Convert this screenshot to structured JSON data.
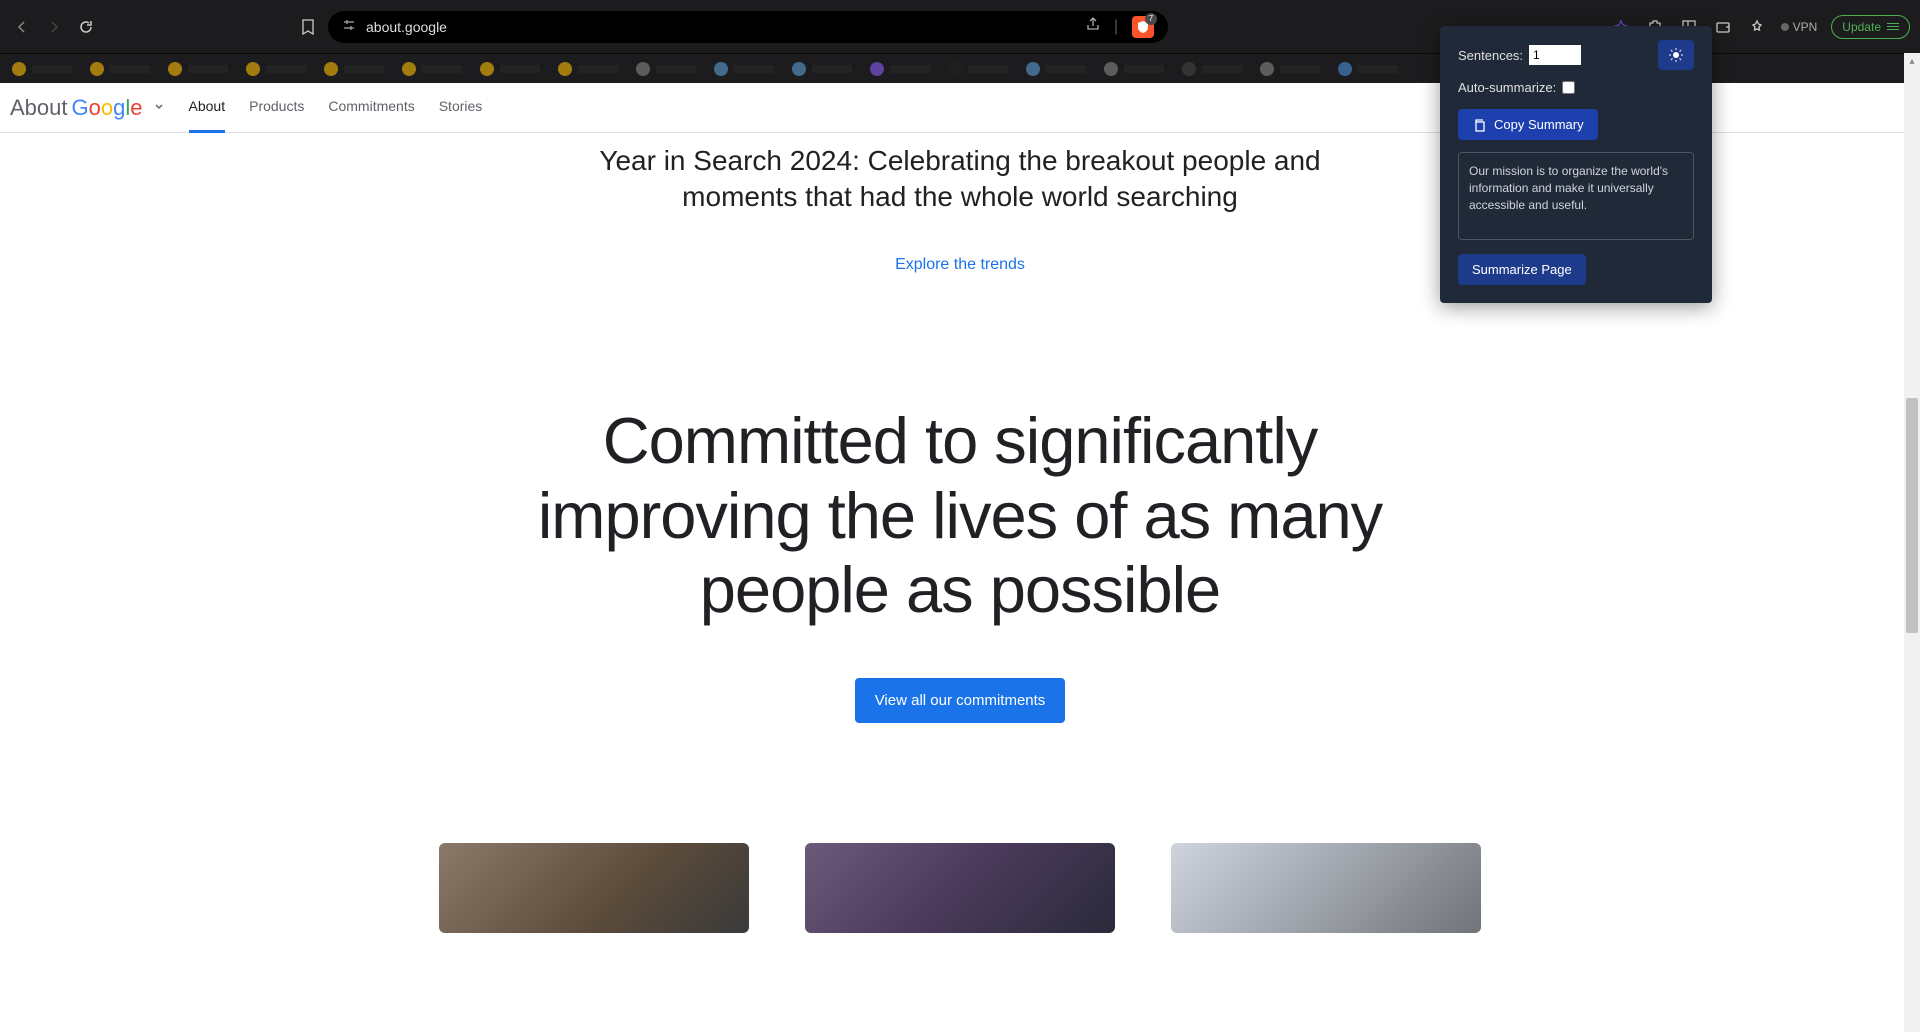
{
  "browser": {
    "url": "about.google",
    "shield_count": "7",
    "vpn_label": "VPN",
    "update_label": "Update"
  },
  "bookmarks": [
    {
      "color": "#fbbc05"
    },
    {
      "color": "#fbbc05"
    },
    {
      "color": "#fbbc05"
    },
    {
      "color": "#fbbc05"
    },
    {
      "color": "#fbbc05"
    },
    {
      "color": "#fbbc05"
    },
    {
      "color": "#fbbc05"
    },
    {
      "color": "#fbbc05"
    },
    {
      "color": "#888888"
    },
    {
      "color": "#5a9fd4"
    },
    {
      "color": "#5a9fd4"
    },
    {
      "color": "#8b5cf6"
    },
    {
      "color": "#222222"
    },
    {
      "color": "#5a9fd4"
    },
    {
      "color": "#888888"
    },
    {
      "color": "#444444"
    },
    {
      "color": "#888888"
    },
    {
      "color": "#4a90d9"
    }
  ],
  "header": {
    "about": "About",
    "tabs": [
      "About",
      "Products",
      "Commitments",
      "Stories"
    ],
    "active_tab": 0
  },
  "content": {
    "hero_subtitle": "Year in Search 2024: Celebrating the breakout people and moments that had the whole world searching",
    "explore_link": "Explore the trends",
    "main_headline": "Committed to significantly improving the lives of as many people as possible",
    "cta_label": "View all our commitments"
  },
  "extension": {
    "sentences_label": "Sentences:",
    "sentences_value": "1",
    "auto_label": "Auto-summarize:",
    "copy_label": "Copy Summary",
    "summary_text": "Our mission is to organize the world's information and make it universally accessible and useful.",
    "summarize_label": "Summarize Page"
  }
}
